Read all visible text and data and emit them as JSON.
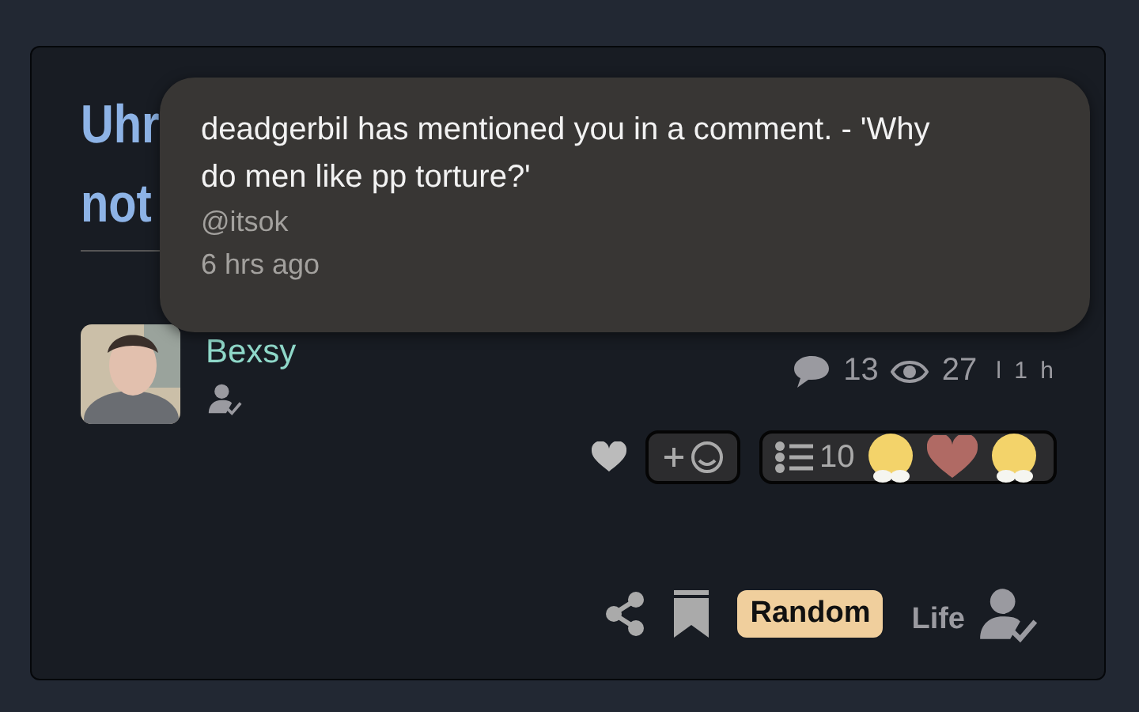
{
  "post": {
    "title_lines": [
      "Uhr",
      "not"
    ],
    "author": {
      "name": "Bexsy"
    },
    "stats": {
      "comments": "13",
      "views": "27",
      "age": "l 1 h"
    },
    "reactions": {
      "count": "10",
      "items": [
        {
          "kind": "emoji"
        },
        {
          "kind": "heart"
        },
        {
          "kind": "emoji"
        }
      ]
    },
    "tag": "Random",
    "category": "Life"
  },
  "notification": {
    "message": "deadgerbil has mentioned you in a comment. - 'Why do men like pp torture?'",
    "handle": "@itsok",
    "time": "6 hrs ago"
  }
}
